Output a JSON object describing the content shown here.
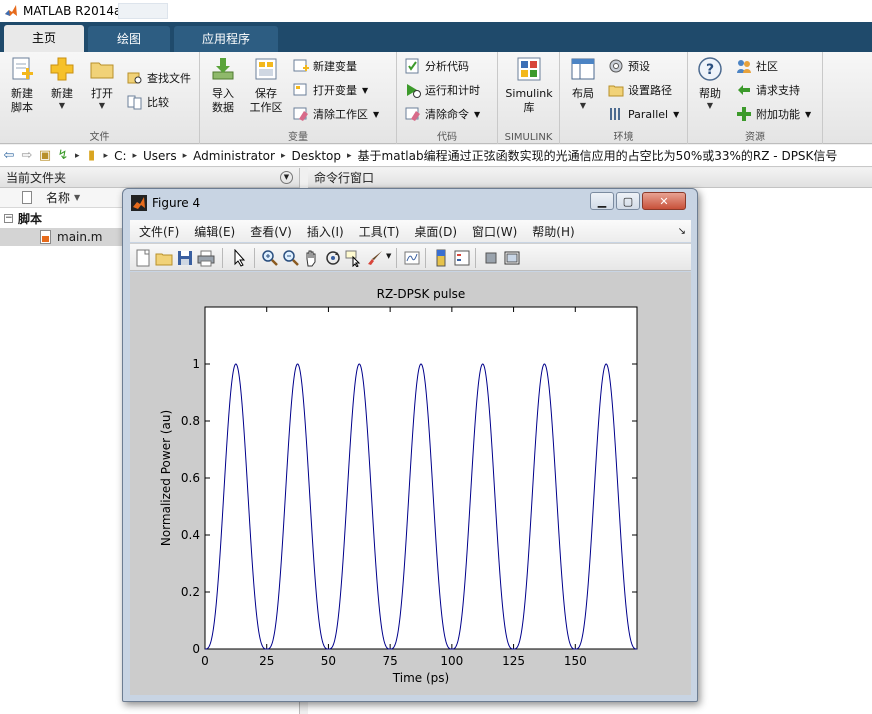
{
  "app": {
    "title": "MATLAB R2014a"
  },
  "tabs": [
    {
      "label": "主页"
    },
    {
      "label": "绘图"
    },
    {
      "label": "应用程序"
    }
  ],
  "ribbon": {
    "file_group": {
      "label": "文件",
      "new_script": [
        "新建",
        "脚本"
      ],
      "new": "新建",
      "open": "打开",
      "find_files": "查找文件",
      "compare": "比较"
    },
    "variable_group": {
      "label": "变量",
      "import_data": [
        "导入",
        "数据"
      ],
      "save_workspace": [
        "保存",
        "工作区"
      ],
      "new_variable": "新建变量",
      "open_variable": "打开变量",
      "clear_workspace": "清除工作区"
    },
    "code_group": {
      "label": "代码",
      "analyze_code": "分析代码",
      "run_and_time": "运行和计时",
      "clear_commands": "清除命令"
    },
    "simulink_group": {
      "label": "SIMULINK",
      "simulink_library": [
        "Simulink",
        "库"
      ]
    },
    "environment_group": {
      "label": "环境",
      "layout": "布局",
      "preferences": "预设",
      "set_path": "设置路径",
      "parallel": "Parallel"
    },
    "resources_group": {
      "label": "资源",
      "help": "帮助",
      "community": "社区",
      "request_support": "请求支持",
      "add_ons": "附加功能"
    }
  },
  "address": {
    "crumbs": [
      "C:",
      "Users",
      "Administrator",
      "Desktop",
      "基于matlab编程通过正弦函数实现的光通信应用的占空比为50%或33%的RZ - DPSK信号"
    ]
  },
  "left_panel": {
    "title": "当前文件夹",
    "column_name": "名称",
    "folder": "脚本",
    "file": "main.m"
  },
  "right_panel": {
    "title": "命令行窗口"
  },
  "figure": {
    "window_title": "Figure 4",
    "menus": [
      "文件(F)",
      "编辑(E)",
      "查看(V)",
      "插入(I)",
      "工具(T)",
      "桌面(D)",
      "窗口(W)",
      "帮助(H)"
    ]
  },
  "colors": {
    "tabbar": "#1f4a6b",
    "curve": "#00008b",
    "figure_bg": "#cccccc"
  },
  "chart_data": {
    "type": "line",
    "title": "RZ-DPSK pulse",
    "xlabel": "Time (ps)",
    "ylabel": "Normalized Power (au)",
    "xlim": [
      0,
      175
    ],
    "ylim": [
      0,
      1.2
    ],
    "xticks": [
      0,
      25,
      50,
      75,
      100,
      125,
      150
    ],
    "yticks": [
      0,
      0.2,
      0.4,
      0.6,
      0.8,
      1
    ],
    "xticklabels": [
      "0",
      "25",
      "50",
      "75",
      100,
      "125",
      "150"
    ],
    "yticklabels": [
      "0",
      "0.2",
      "0.4",
      "0.6",
      "0.8",
      "1"
    ],
    "period_ps": 25,
    "peak_times_ps": [
      12.5,
      37.5,
      62.5,
      87.5,
      112.5,
      137.5,
      162.5
    ],
    "peak_value": 1,
    "grid": false,
    "legend": "none"
  }
}
